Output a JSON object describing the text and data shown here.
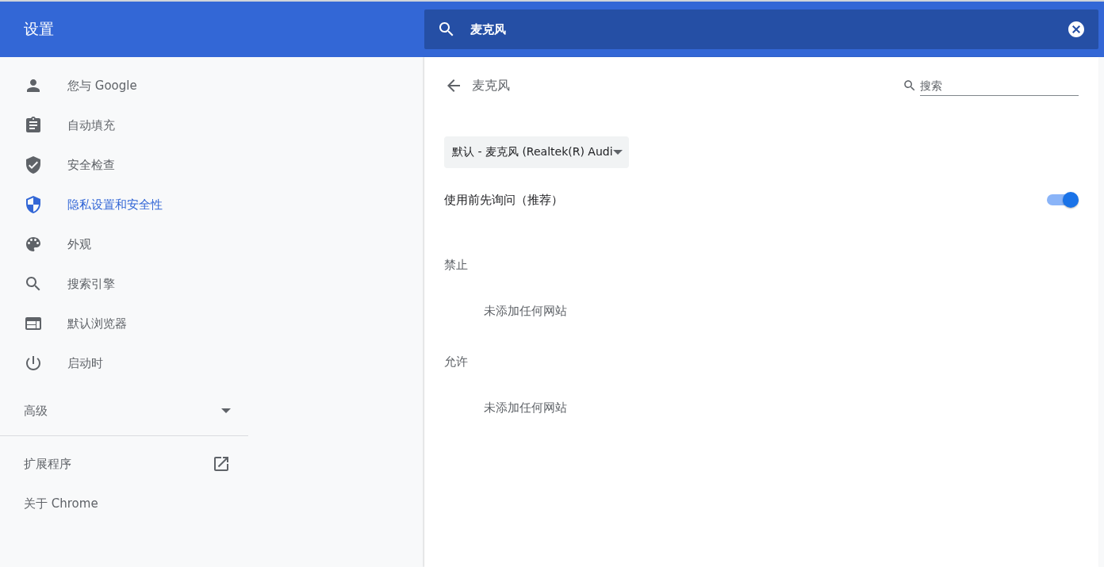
{
  "header": {
    "title": "设置"
  },
  "search": {
    "value": "麦克风"
  },
  "sidebar": {
    "items": [
      {
        "label": "您与 Google",
        "selected": false
      },
      {
        "label": "自动填充",
        "selected": false
      },
      {
        "label": "安全检查",
        "selected": false
      },
      {
        "label": "隐私设置和安全性",
        "selected": true
      },
      {
        "label": "外观",
        "selected": false
      },
      {
        "label": "搜索引擎",
        "selected": false
      },
      {
        "label": "默认浏览器",
        "selected": false
      },
      {
        "label": "启动时",
        "selected": false
      }
    ],
    "advanced": {
      "label": "高级",
      "expanded": false
    },
    "links": [
      {
        "label": "扩展程序",
        "kind": "external"
      },
      {
        "label": "关于 Chrome",
        "kind": "plain"
      }
    ]
  },
  "page": {
    "title": "麦克风",
    "search": {
      "placeholder": "搜索"
    },
    "device": {
      "value": "默认 - 麦克风 (Realtek(R) Audi"
    },
    "ask": {
      "label": "使用前先询问（推荐）",
      "on": true
    },
    "sections": [
      {
        "heading": "禁止",
        "empty": "未添加任何网站"
      },
      {
        "heading": "允许",
        "empty": "未添加任何网站"
      }
    ]
  }
}
